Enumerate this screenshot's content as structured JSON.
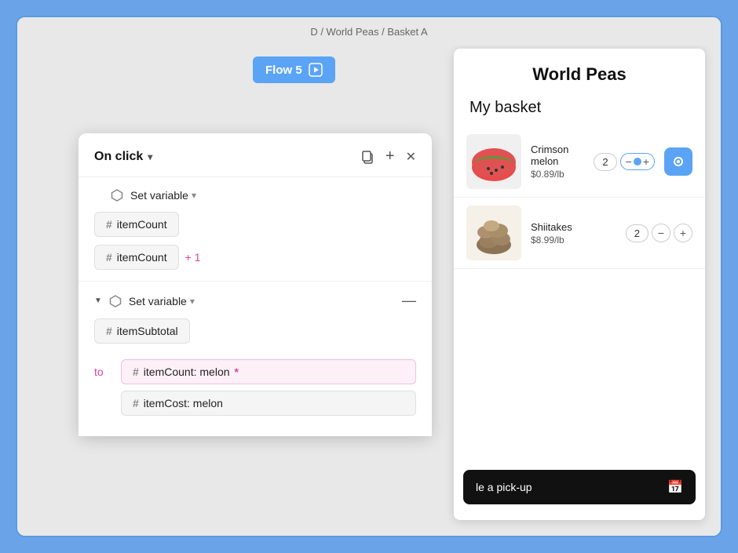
{
  "breadcrumb": {
    "text": "D / World Peas / Basket A"
  },
  "flow_button": {
    "label": "Flow 5",
    "icon": "▶"
  },
  "content_card": {
    "title": "World Peas",
    "basket_title": "My basket",
    "products": [
      {
        "name": "Crimson melon",
        "price": "$0.89/lb",
        "quantity": "2",
        "type": "watermelon"
      },
      {
        "name": "Shiitakes",
        "price": "$8.99/lb",
        "quantity": "2",
        "type": "mushroom"
      }
    ],
    "schedule_label": "le a pick-up"
  },
  "action_panel": {
    "trigger_label": "On click",
    "chevron": "▾",
    "sections": [
      {
        "id": "section1",
        "title": "Set variable",
        "variable_name": "itemCount",
        "value_chip": "itemCount",
        "value_suffix": "+ 1",
        "has_collapse_arrow": false
      },
      {
        "id": "section2",
        "title": "Set variable",
        "variable_name": "itemSubtotal",
        "has_collapse_arrow": true
      }
    ],
    "to_label": "to",
    "to_items": [
      {
        "text": "itemCount: melon",
        "has_asterisk": true
      },
      {
        "text": "itemCost: melon",
        "has_asterisk": false
      }
    ],
    "icons": {
      "copy": "⊡",
      "add": "+",
      "close": "✕"
    }
  }
}
